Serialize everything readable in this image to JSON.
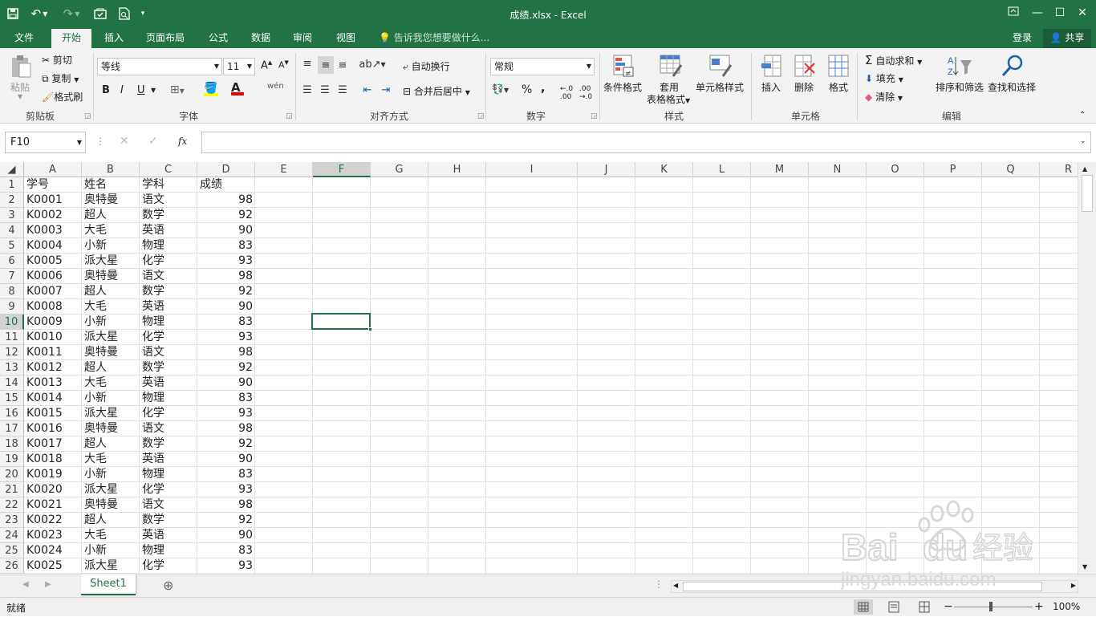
{
  "titlebar": {
    "title": "成绩.xlsx - Excel",
    "save_icon": "save-icon",
    "undo_icon": "undo-icon",
    "redo_icon": "redo-icon",
    "minimize": "—",
    "maximize": "☐",
    "close": "✕"
  },
  "tabs": [
    "文件",
    "开始",
    "插入",
    "页面布局",
    "公式",
    "数据",
    "审阅",
    "视图"
  ],
  "tellme": "告诉我您想要做什么...",
  "account": {
    "login": "登录",
    "share": "共享"
  },
  "ribbon": {
    "clipboard": {
      "paste": "粘贴",
      "cut": "剪切",
      "copy": "复制",
      "format_painter": "格式刷",
      "label": "剪贴板"
    },
    "font": {
      "name": "等线",
      "size": "11",
      "label": "字体",
      "bold": "B",
      "italic": "I",
      "underline": "U",
      "phonetic": "wén"
    },
    "alignment": {
      "wrap": "自动换行",
      "merge": "合并后居中",
      "label": "对齐方式"
    },
    "number": {
      "format": "常规",
      "label": "数字",
      "percent": "%",
      "comma": ","
    },
    "styles": {
      "conditional": "条件格式",
      "table_a": "套用",
      "table_b": "表格格式",
      "cell_styles": "单元格样式",
      "label": "样式"
    },
    "cells": {
      "insert": "插入",
      "delete": "删除",
      "format": "格式",
      "label": "单元格"
    },
    "editing": {
      "autosum": "自动求和",
      "fill": "填充",
      "clear": "清除",
      "sort": "排序和筛选",
      "find": "查找和选择",
      "label": "编辑"
    }
  },
  "formula_bar": {
    "name_box": "F10",
    "fx": "fx",
    "value": ""
  },
  "columns": [
    "A",
    "B",
    "C",
    "D",
    "E",
    "F",
    "G",
    "H",
    "I",
    "J",
    "K",
    "L",
    "M",
    "N",
    "O",
    "P",
    "Q",
    "R"
  ],
  "active_cell": "F10",
  "rows": [
    [
      "学号",
      "姓名",
      "学科",
      "成绩"
    ],
    [
      "K0001",
      "奥特曼",
      "语文",
      "98"
    ],
    [
      "K0002",
      "超人",
      "数学",
      "92"
    ],
    [
      "K0003",
      "大毛",
      "英语",
      "90"
    ],
    [
      "K0004",
      "小新",
      "物理",
      "83"
    ],
    [
      "K0005",
      "派大星",
      "化学",
      "93"
    ],
    [
      "K0006",
      "奥特曼",
      "语文",
      "98"
    ],
    [
      "K0007",
      "超人",
      "数学",
      "92"
    ],
    [
      "K0008",
      "大毛",
      "英语",
      "90"
    ],
    [
      "K0009",
      "小新",
      "物理",
      "83"
    ],
    [
      "K0010",
      "派大星",
      "化学",
      "93"
    ],
    [
      "K0011",
      "奥特曼",
      "语文",
      "98"
    ],
    [
      "K0012",
      "超人",
      "数学",
      "92"
    ],
    [
      "K0013",
      "大毛",
      "英语",
      "90"
    ],
    [
      "K0014",
      "小新",
      "物理",
      "83"
    ],
    [
      "K0015",
      "派大星",
      "化学",
      "93"
    ],
    [
      "K0016",
      "奥特曼",
      "语文",
      "98"
    ],
    [
      "K0017",
      "超人",
      "数学",
      "92"
    ],
    [
      "K0018",
      "大毛",
      "英语",
      "90"
    ],
    [
      "K0019",
      "小新",
      "物理",
      "83"
    ],
    [
      "K0020",
      "派大星",
      "化学",
      "93"
    ],
    [
      "K0021",
      "奥特曼",
      "语文",
      "98"
    ],
    [
      "K0022",
      "超人",
      "数学",
      "92"
    ],
    [
      "K0023",
      "大毛",
      "英语",
      "90"
    ],
    [
      "K0024",
      "小新",
      "物理",
      "83"
    ],
    [
      "K0025",
      "派大星",
      "化学",
      "93"
    ]
  ],
  "sheet_tab": "Sheet1",
  "status": {
    "ready": "就绪",
    "zoom": "100%"
  },
  "watermark": {
    "brand": "Bai du 经验",
    "url": "jingyan.baidu.com"
  },
  "colors": {
    "accent": "#217346",
    "grid": "#e1e1e1"
  }
}
